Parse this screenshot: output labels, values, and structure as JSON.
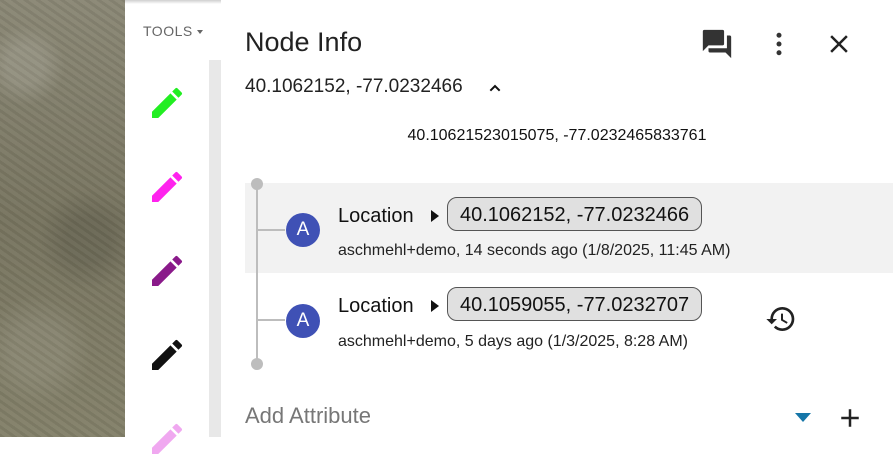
{
  "map": {
    "description_icon": "satellite-map-tile"
  },
  "toolbar": {
    "label": "TOOLS",
    "pencils": [
      {
        "color": "#22ee22",
        "name": "pencil-green-icon"
      },
      {
        "color": "#ff22ee",
        "name": "pencil-magenta-icon"
      },
      {
        "color": "#8a1a8a",
        "name": "pencil-purple-icon"
      },
      {
        "color": "#111111",
        "name": "pencil-black-icon"
      },
      {
        "color": "#f0a8f0",
        "name": "pencil-pink-icon"
      }
    ]
  },
  "panel": {
    "title": "Node Info",
    "coords": "40.1062152, -77.0232466",
    "precise_coords": "40.10621523015075, -77.0232465833761",
    "history": [
      {
        "avatar": "A",
        "label": "Location",
        "value": "40.1062152, -77.0232466",
        "meta": "aschmehl+demo, 14 seconds ago (1/8/2025, 11:45 AM)",
        "selected": true
      },
      {
        "avatar": "A",
        "label": "Location",
        "value": "40.1059055, -77.0232707",
        "meta": "aschmehl+demo, 5 days ago (1/3/2025, 8:28 AM)",
        "selected": false
      }
    ],
    "add_attribute_placeholder": "Add Attribute"
  },
  "colors": {
    "avatar": "#3f51b5",
    "accent": "#1576a8"
  }
}
